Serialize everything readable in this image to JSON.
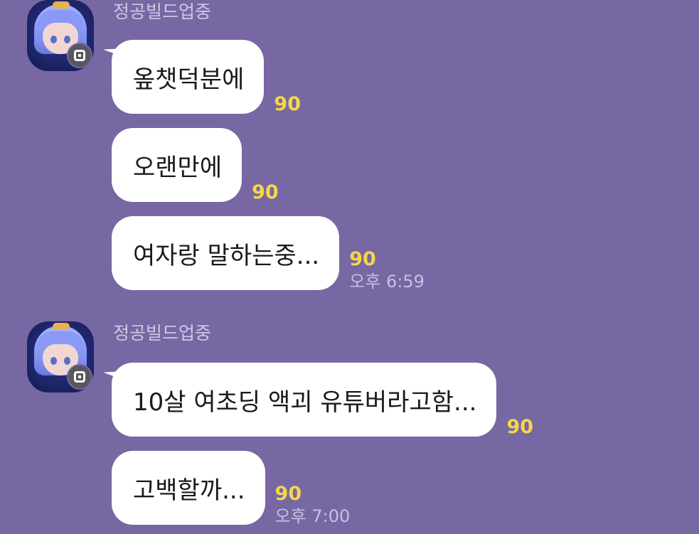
{
  "chat": {
    "groups": [
      {
        "sender": "정공빌드업중",
        "messages": [
          {
            "text": "옾챗덕분에",
            "unread": "90",
            "time": ""
          },
          {
            "text": "오랜만에",
            "unread": "90",
            "time": ""
          },
          {
            "text": "여자랑 말하는중...",
            "unread": "90",
            "time": "오후 6:59"
          }
        ]
      },
      {
        "sender": "정공빌드업중",
        "messages": [
          {
            "text": "10살 여초딩 액괴 유튜버라고함...",
            "unread": "90",
            "time": ""
          },
          {
            "text": "고백할까...",
            "unread": "90",
            "time": "오후 7:00"
          }
        ]
      }
    ]
  },
  "colors": {
    "background": "#7767a2",
    "bubble": "#ffffff",
    "unread": "#f5d64b",
    "sender": "#cfc8e6"
  },
  "icons": {
    "avatar": "anime-girl-avatar",
    "badge": "openchat-host-badge"
  }
}
